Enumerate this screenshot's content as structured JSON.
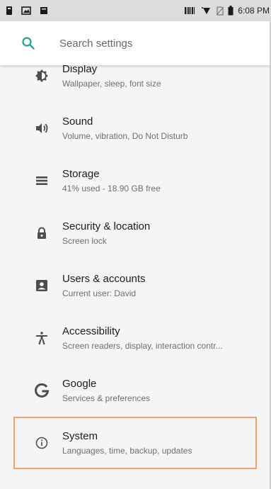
{
  "status_bar": {
    "time": "6:08 PM",
    "left_icons": [
      "sim-icon",
      "image-icon",
      "message-icon"
    ],
    "right_icons": [
      "barcode-icon",
      "wifi-icon",
      "no-sim-icon",
      "battery-icon"
    ]
  },
  "search": {
    "placeholder": "Search settings"
  },
  "settings_items": [
    {
      "title": "Display",
      "subtitle": "Wallpaper, sleep, font size",
      "icon": "display-brightness-icon"
    },
    {
      "title": "Sound",
      "subtitle": "Volume, vibration, Do Not Disturb",
      "icon": "volume-icon"
    },
    {
      "title": "Storage",
      "subtitle": "41% used - 18.90 GB free",
      "icon": "storage-icon"
    },
    {
      "title": "Security & location",
      "subtitle": "Screen lock",
      "icon": "lock-icon"
    },
    {
      "title": "Users & accounts",
      "subtitle": "Current user: David",
      "icon": "account-box-icon"
    },
    {
      "title": "Accessibility",
      "subtitle": "Screen readers, display, interaction contr...",
      "icon": "accessibility-icon"
    },
    {
      "title": "Google",
      "subtitle": "Services & preferences",
      "icon": "google-icon"
    },
    {
      "title": "System",
      "subtitle": "Languages, time, backup, updates",
      "icon": "info-icon"
    }
  ],
  "colors": {
    "accent": "#2b9e92",
    "highlight_border": "#f0a06a",
    "icon": "#4d4d4d"
  }
}
